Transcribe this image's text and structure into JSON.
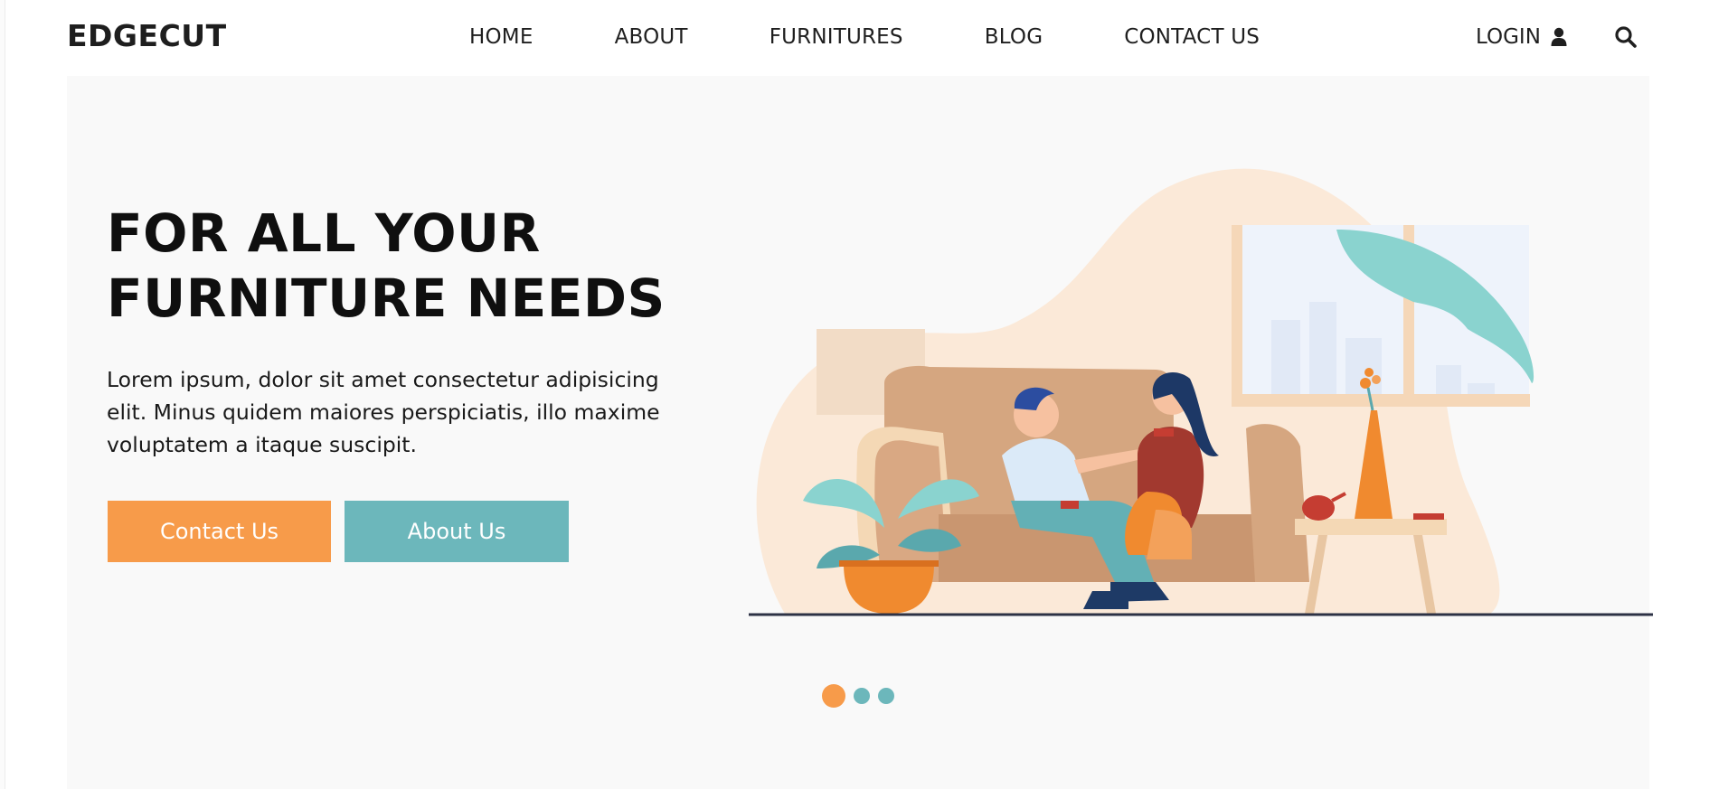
{
  "brand": "EDGECUT",
  "nav": {
    "items": [
      {
        "label": "HOME"
      },
      {
        "label": "ABOUT"
      },
      {
        "label": "FURNITURES"
      },
      {
        "label": "BLOG"
      },
      {
        "label": "CONTACT US"
      }
    ],
    "login_label": "LOGIN",
    "user_icon": "user-icon",
    "search_icon": "search-icon"
  },
  "hero": {
    "title": "FOR ALL YOUR FURNITURE NEEDS",
    "text": "Lorem ipsum, dolor sit amet consectetur adipisicing elit. Minus quidem maiores perspiciatis, illo maxime voluptatem a itaque suscipit.",
    "contact_button": "Contact Us",
    "about_button": "About Us",
    "slider": {
      "total": 3,
      "active_index": 0
    }
  },
  "colors": {
    "accent_orange": "#f79b4a",
    "accent_teal": "#6cb7bb",
    "hero_bg": "#f9f9f9"
  }
}
